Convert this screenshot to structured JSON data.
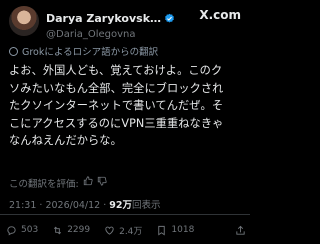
{
  "author": {
    "display_name": "Darya Zarykovsk…",
    "handle": "@Daria_Olegovna",
    "verified_icon": "verified-badge-icon",
    "platform_logo": "X.com"
  },
  "translation_note": "Grokによるロシア語からの翻訳",
  "post": {
    "lines": [
      "よお、外国人ども、覚えておけよ。このク",
      "ソみたいなもん全部、完全にブロックされ",
      "たクソインターネットで書いてんだぜ。そ",
      "こにアクセスするのにVPN三重重ねなきゃ",
      "なんねえんだからな。"
    ]
  },
  "rate_translation": "この翻訳を評価:",
  "meta": {
    "time": "21:31",
    "date": "2026/04/12",
    "views_count": "92万",
    "views_label": "回表示"
  },
  "actions": {
    "replies": "503",
    "reposts": "2299",
    "likes": "2.4万",
    "bookmarks": "1018"
  },
  "colors": {
    "background": "#000000",
    "text": "#e7e9ea",
    "muted": "#71767b",
    "verified": "#1d9bf0"
  }
}
